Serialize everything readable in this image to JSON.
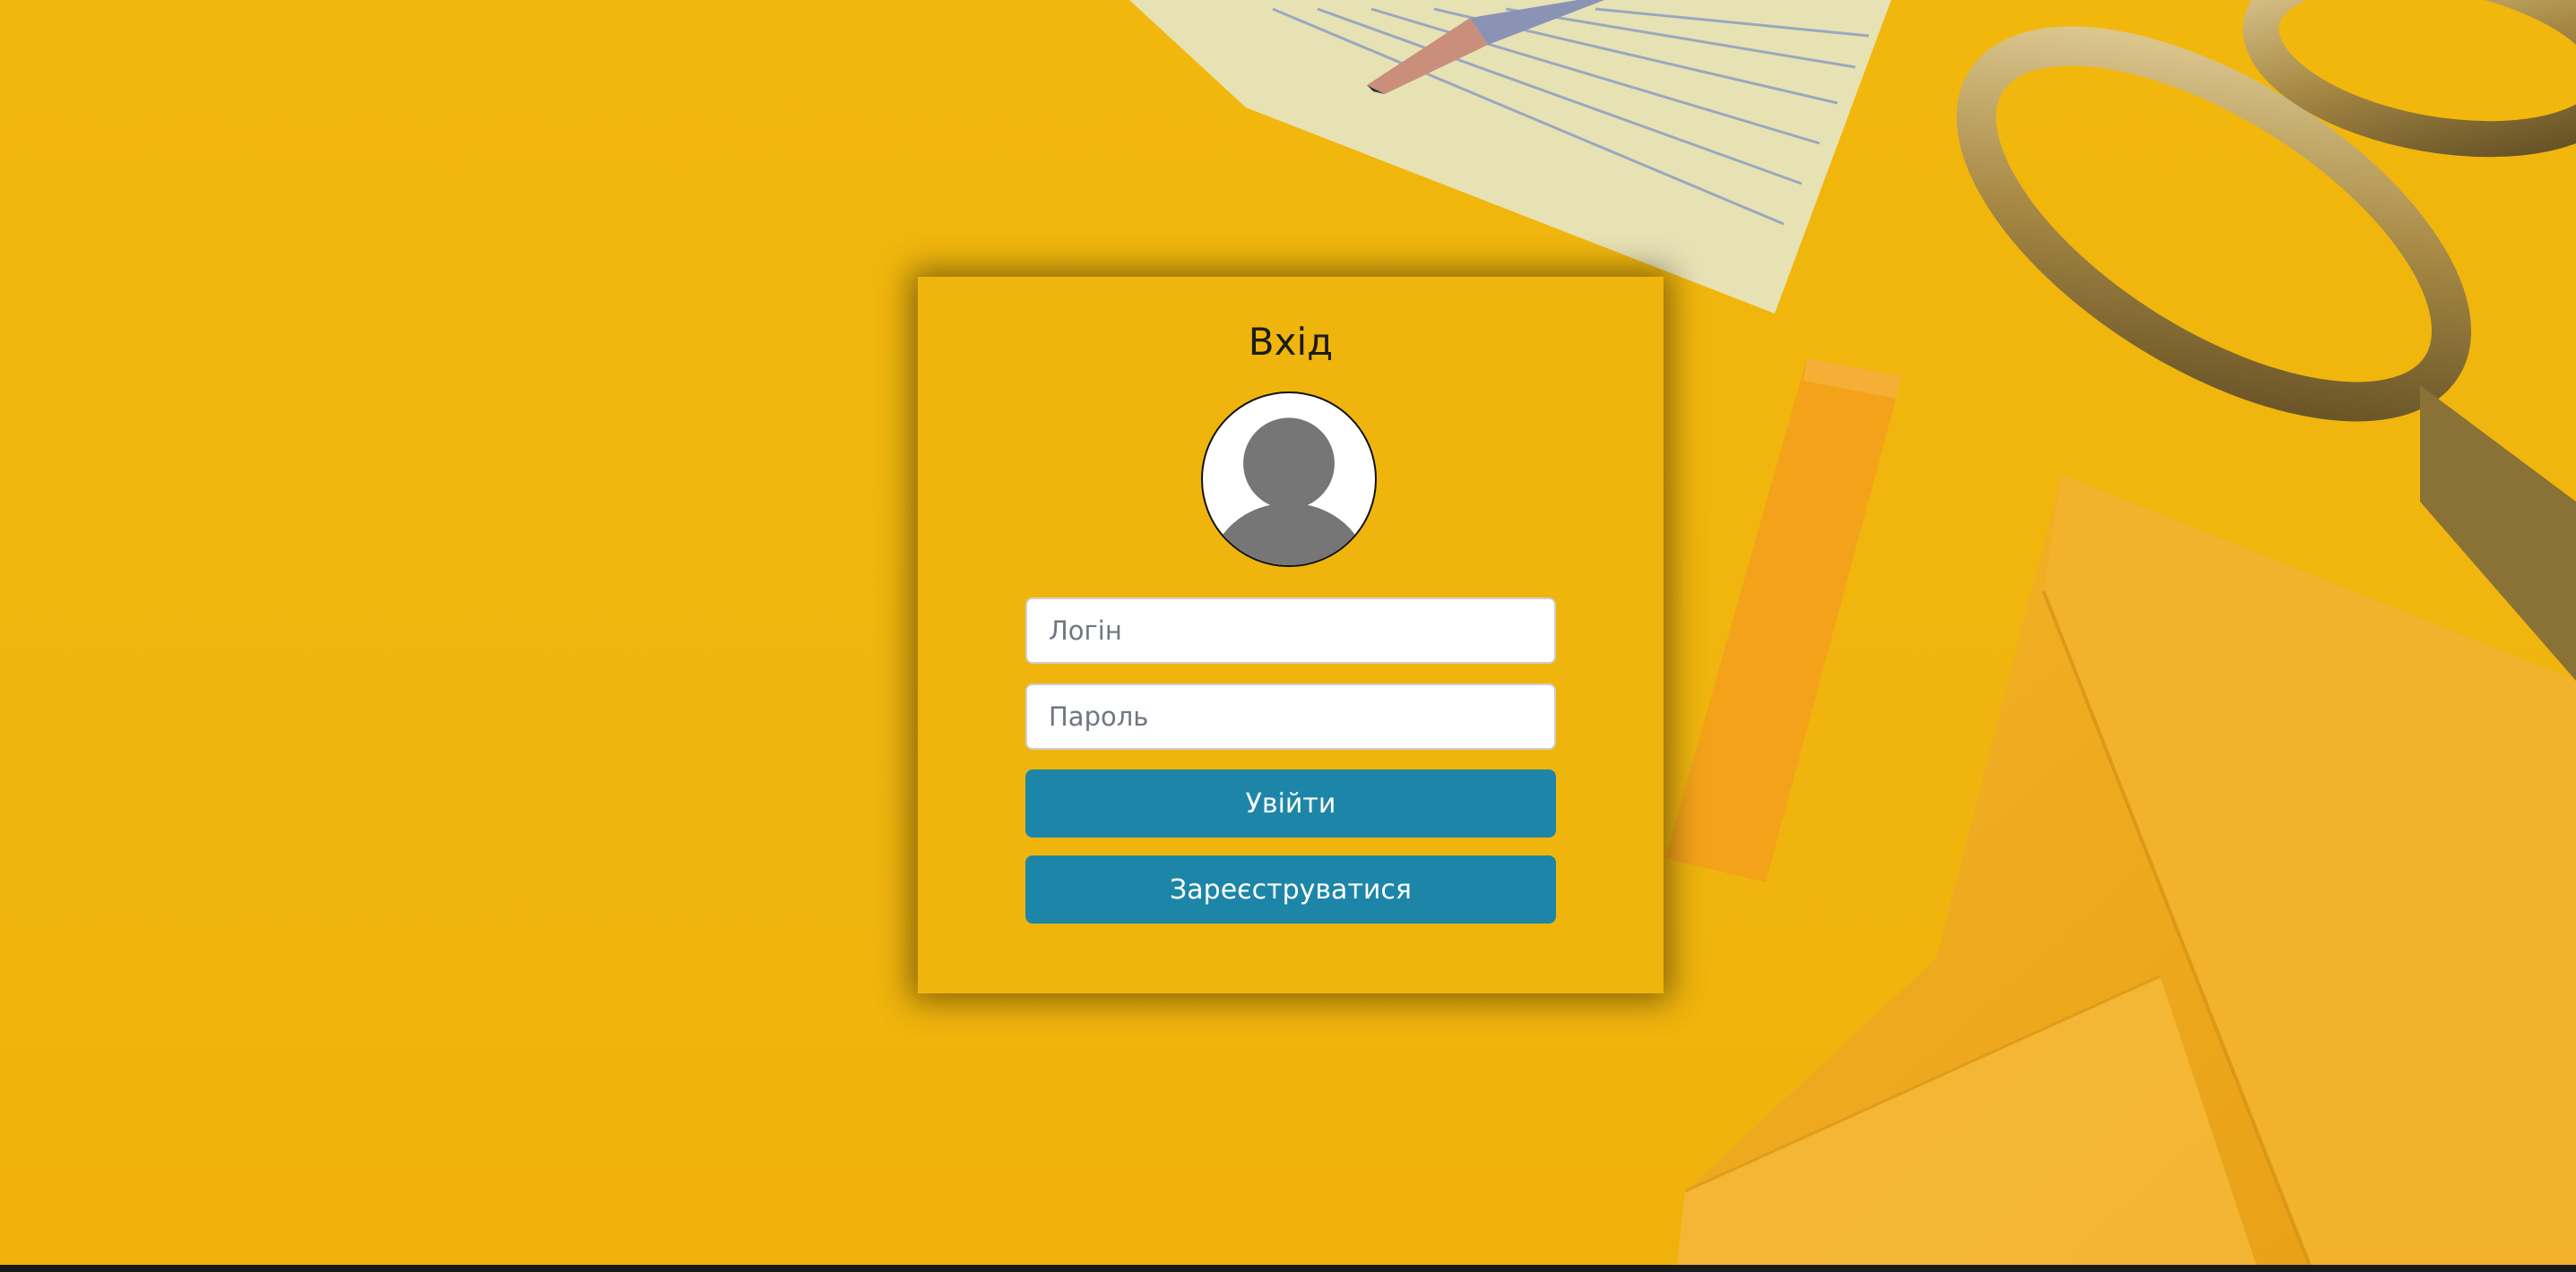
{
  "page": {
    "background_color": "#f2b70c"
  },
  "login_form": {
    "title": "Вхід",
    "avatar_icon": "user-silhouette-icon",
    "login_placeholder": "Логін",
    "password_placeholder": "Пароль",
    "login_button_label": "Увійти",
    "register_button_label": "Зареєструватися",
    "card_color": "#efb50c",
    "button_color": "#1d86a8"
  },
  "decor": {
    "items": [
      "pencil",
      "notepad",
      "scissors",
      "sticky-note",
      "envelope"
    ]
  }
}
